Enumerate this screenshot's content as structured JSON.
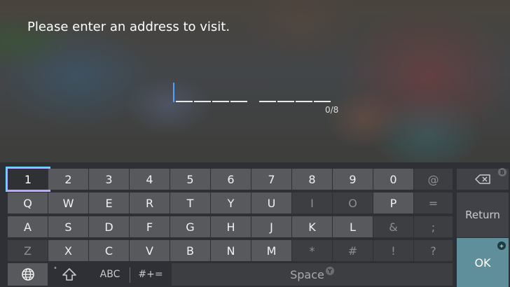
{
  "prompt": "Please enter an address to visit.",
  "counter": "0/8",
  "rows": [
    [
      "1",
      "2",
      "3",
      "4",
      "5",
      "6",
      "7",
      "8",
      "9",
      "0",
      "@"
    ],
    [
      "Q",
      "W",
      "E",
      "R",
      "T",
      "Y",
      "U",
      "I",
      "O",
      "P",
      "="
    ],
    [
      "A",
      "S",
      "D",
      "F",
      "G",
      "H",
      "J",
      "K",
      "L",
      "&",
      ";"
    ],
    [
      "Z",
      "X",
      "C",
      "V",
      "B",
      "N",
      "M",
      "*",
      "#",
      "!",
      "?"
    ]
  ],
  "bottom": {
    "abc_label": "ABC",
    "symbols_label": "#+=",
    "space_label": "Space",
    "space_badge": "Y"
  },
  "side": {
    "backspace_badge": "B",
    "return_label": "Return",
    "ok_label": "OK",
    "ok_badge": "+"
  },
  "colors": {
    "focus_ring": "#b8a6ff",
    "cursor": "#4fa3ff",
    "ok_bg": "#5f8f9a"
  }
}
